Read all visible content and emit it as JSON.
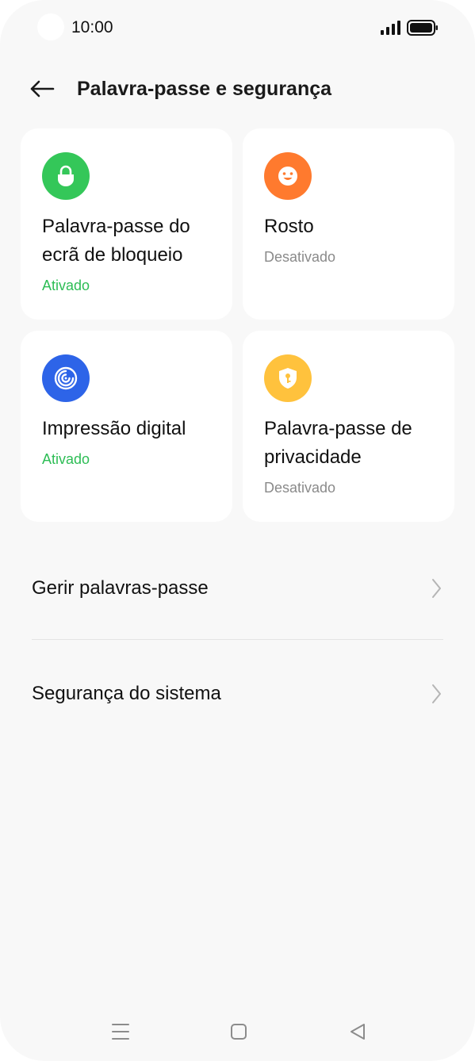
{
  "status_bar": {
    "time": "10:00"
  },
  "header": {
    "title": "Palavra-passe e segurança"
  },
  "cards": {
    "lock": {
      "title": "Palavra-passe do ecrã de bloqueio",
      "status": "Ativado",
      "color": "#34c759"
    },
    "face": {
      "title": "Rosto",
      "status": "Desativado",
      "color": "#ff7a2e"
    },
    "fingerprint": {
      "title": "Impressão digital",
      "status": "Ativado",
      "color": "#2d64e8"
    },
    "privacy": {
      "title": "Palavra-passe de privacidade",
      "status": "Desativado",
      "color": "#ffc23d"
    }
  },
  "list": {
    "manage_passwords": "Gerir palavras-passe",
    "system_security": "Segurança do sistema"
  },
  "colors": {
    "status_on": "#2dbd55",
    "status_off": "#8a8a8a",
    "background": "#f8f8f8"
  }
}
